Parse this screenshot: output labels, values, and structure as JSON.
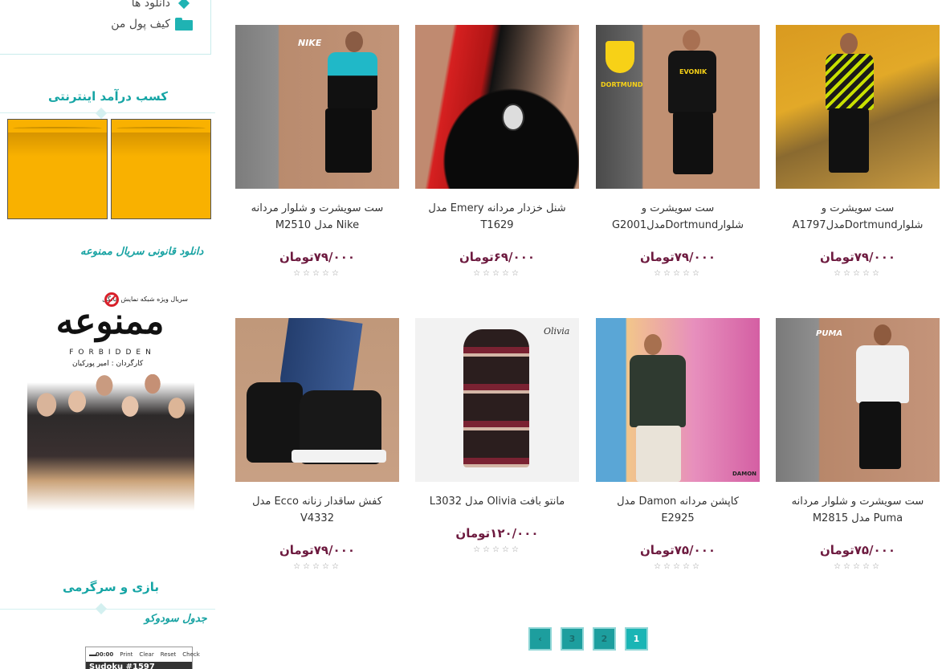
{
  "sidebar": {
    "links": [
      {
        "label": "دانلود ها",
        "icon": "diamond-icon"
      },
      {
        "label": "کیف پول من",
        "icon": "folder-icon"
      }
    ],
    "earn_title": "کسب درآمد اینترنتی",
    "series_title": "دانلود قانونی سریال ممنوعه",
    "poster": {
      "top_line": "سریال ویژه شبکه نمایش خانگی",
      "title": "ممنوعه",
      "english": "FORBIDDEN",
      "director": "کارگردان : امیر پورکیان"
    },
    "games_title": "بازی و سرگرمی",
    "sudoku_title": "جدول سودوکو",
    "sudoku": {
      "time": "00:00",
      "actions": [
        "Print",
        "Clear",
        "Reset",
        "Check"
      ],
      "header": "Sudoku #1597"
    }
  },
  "products": [
    {
      "name": "ست سویشرت و شلوار مردانه Nike مدل M2510",
      "price": "۷۹/۰۰۰تومان",
      "stars": "☆☆☆☆☆",
      "image": "nike-tracksuit"
    },
    {
      "name": "شنل خزدار مردانه Emery مدل T1629",
      "price": "۶۹/۰۰۰تومان",
      "stars": "☆☆☆☆☆",
      "image": "fur-cloak"
    },
    {
      "name": "ست سویشرت و شلوارDortmundمدلG2001",
      "price": "۷۹/۰۰۰تومان",
      "stars": "☆☆☆☆☆",
      "image": "dortmund-tracksuit"
    },
    {
      "name": "ست سویشرت و شلوارDortmundمدلA1797",
      "price": "۷۹/۰۰۰تومان",
      "stars": "☆☆☆☆☆",
      "image": "dortmund-tracksuit-yellow"
    },
    {
      "name": "کفش ساقدار زنانه Ecco مدل V4332",
      "price": "۷۹/۰۰۰تومان",
      "stars": "☆☆☆☆☆",
      "image": "ecco-boot"
    },
    {
      "name": "مانتو بافت Olivia مدل L3032",
      "price": "۱۲۰/۰۰۰تومان",
      "stars": "☆☆☆☆☆",
      "image": "olivia-coat"
    },
    {
      "name": "کاپشن مردانه Damon مدل E2925",
      "price": "۷۵/۰۰۰تومان",
      "stars": "☆☆☆☆☆",
      "image": "damon-jacket"
    },
    {
      "name": "ست سویشرت و شلوار مردانه Puma مدل M2815",
      "price": "۷۵/۰۰۰تومان",
      "stars": "☆☆☆☆☆",
      "image": "puma-tracksuit"
    }
  ],
  "image_labels": {
    "nike": "NIKE",
    "dortmund": "DORTMUND",
    "evonik": "EVONIK",
    "olivia": "Olivia",
    "damon": "DAMON",
    "puma": "PUMA"
  },
  "pagination": {
    "prev": "‹",
    "pages": [
      "1",
      "2",
      "3"
    ],
    "current": "1"
  },
  "colors": {
    "accent": "#1ab5b5",
    "price": "#6d1a3f",
    "ad": "#f9b100"
  }
}
